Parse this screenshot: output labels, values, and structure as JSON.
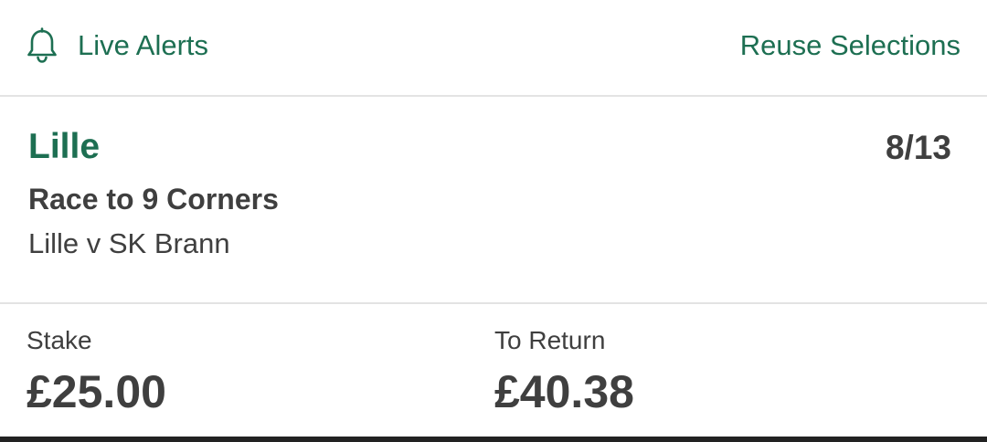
{
  "header": {
    "live_alerts_label": "Live Alerts",
    "reuse_selections_label": "Reuse Selections",
    "bell_icon": "bell-icon"
  },
  "selection": {
    "team": "Lille",
    "odds": "8/13",
    "market": "Race to 9 Corners",
    "event": "Lille v SK Brann"
  },
  "bet": {
    "stake_label": "Stake",
    "stake_value": "£25.00",
    "return_label": "To Return",
    "return_value": "£40.38"
  },
  "colors": {
    "accent_green": "#1d6f52",
    "text_dark": "#3f3f3f",
    "divider": "#e3e3e3"
  }
}
